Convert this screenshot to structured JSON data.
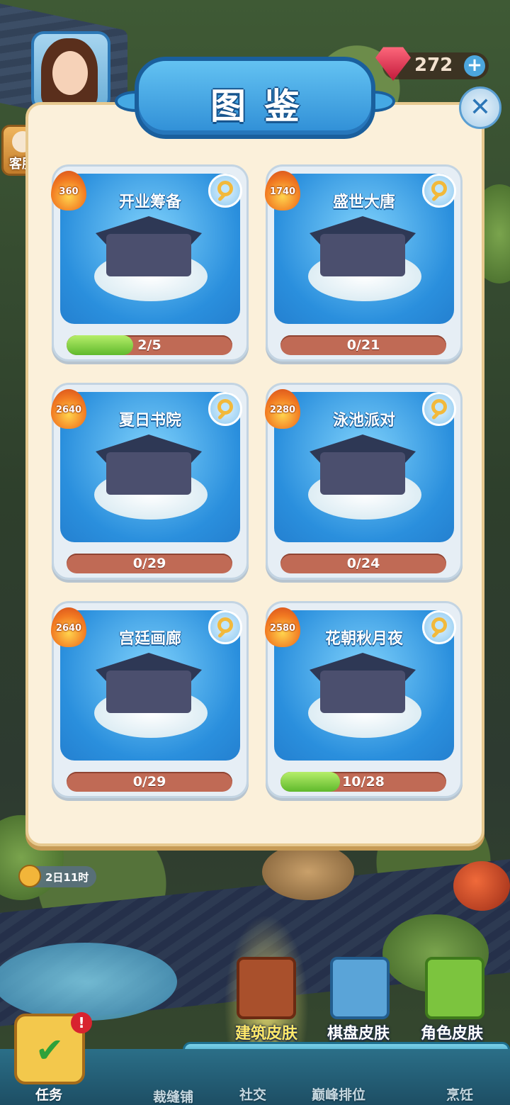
{
  "hud": {
    "gems": "272",
    "gem_plus": "+",
    "service_label": "客服",
    "timer": "2日11时"
  },
  "modal": {
    "title": "图鉴",
    "close": "✕"
  },
  "cards": [
    {
      "title": "开业筹备",
      "heat": "360",
      "progress": "2/5",
      "fraction": 0.4
    },
    {
      "title": "盛世大唐",
      "heat": "1740",
      "progress": "0/21",
      "fraction": 0
    },
    {
      "title": "夏日书院",
      "heat": "2640",
      "progress": "0/29",
      "fraction": 0
    },
    {
      "title": "泳池派对",
      "heat": "2280",
      "progress": "0/24",
      "fraction": 0
    },
    {
      "title": "宫廷画廊",
      "heat": "2640",
      "progress": "0/29",
      "fraction": 0
    },
    {
      "title": "花朝秋月夜",
      "heat": "2580",
      "progress": "10/28",
      "fraction": 0.357
    }
  ],
  "skin_tabs": [
    {
      "label": "建筑皮肤",
      "active": true
    },
    {
      "label": "棋盘皮肤",
      "active": false
    },
    {
      "label": "角色皮肤",
      "active": false
    }
  ],
  "nav": {
    "task": "任务",
    "tailor": "裁缝铺",
    "social": "社交",
    "rank": "巅峰排位",
    "cooking": "烹饪"
  },
  "colors": {
    "accent_blue": "#2f8ed6",
    "panel_bg": "#fbf0da",
    "progress_fill": "#5fb92c",
    "progress_track": "#c06a55"
  }
}
